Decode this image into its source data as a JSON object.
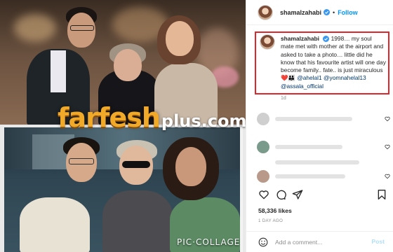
{
  "post": {
    "username": "shamalzahabi",
    "follow_label": "Follow",
    "separator": "•",
    "verified": true
  },
  "caption": {
    "username": "shamalzahabi",
    "text": "1998… my soul mate met with mother at the airport and asked to take a photo… little did he know that his favourite artist will one day become family.. fate.. is just miraculous",
    "emojis": "❤️👪",
    "mentions": [
      "@ahelal1",
      "@yomnahelal13",
      "@assala_official"
    ],
    "time": "1d"
  },
  "comments": [
    {
      "heart": true
    },
    {
      "heart": true
    },
    {
      "heart": true
    },
    {
      "heart": true
    }
  ],
  "engagement": {
    "likes": "58,336 likes",
    "date": "1 DAY AGO"
  },
  "add_comment": {
    "placeholder": "Add a comment...",
    "post_label": "Post"
  },
  "media": {
    "watermark_main": "farfesh",
    "watermark_sub": "plus.com",
    "collage_label": "PIC·COLLAGE"
  },
  "icons": [
    "verified-badge-icon",
    "heart-icon",
    "comment-icon",
    "share-icon",
    "bookmark-icon",
    "emoji-icon"
  ],
  "colors": {
    "accent_blue": "#0095f6",
    "mention_blue": "#00376b",
    "highlight_red": "#e0262d",
    "watermark_orange": "#f0a928"
  }
}
